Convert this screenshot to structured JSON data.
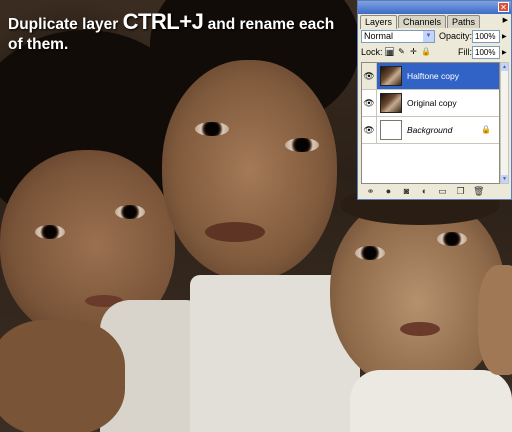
{
  "instruction": {
    "prefix": "Duplicate layer ",
    "shortcut": "CTRL+J",
    "suffix": " and rename each of them."
  },
  "layers_panel": {
    "tabs": [
      {
        "label": "Layers",
        "active": true
      },
      {
        "label": "Channels",
        "active": false
      },
      {
        "label": "Paths",
        "active": false
      }
    ],
    "blend_mode": "Normal",
    "opacity_label": "Opacity:",
    "opacity_value": "100%",
    "lock_label": "Lock:",
    "fill_label": "Fill:",
    "fill_value": "100%",
    "layers": [
      {
        "name": "Halftone copy",
        "selected": true,
        "visible": true,
        "locked": false
      },
      {
        "name": "Original copy",
        "selected": false,
        "visible": true,
        "locked": false
      },
      {
        "name": "Background",
        "selected": false,
        "visible": true,
        "locked": true
      }
    ],
    "bottom_icons": [
      "link-icon",
      "fx-icon",
      "mask-icon",
      "adjustment-icon",
      "group-icon",
      "new-layer-icon",
      "trash-icon"
    ],
    "colors": {
      "panel_bg": "#ece9d8",
      "selection": "#3163c6",
      "title": "#3c6cc8"
    }
  }
}
